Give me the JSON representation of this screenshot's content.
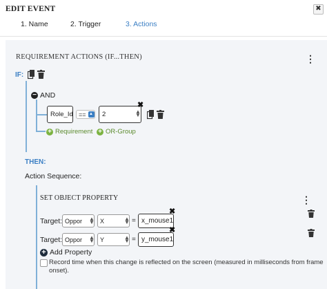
{
  "dialog": {
    "title": "EDIT EVENT",
    "close": "✖"
  },
  "steps": [
    {
      "label": "1. Name"
    },
    {
      "label": "2. Trigger"
    },
    {
      "label": "3. Actions"
    }
  ],
  "requirement": {
    "title": "REQUIREMENT ACTIONS (IF...THEN)",
    "menu_icon": "⋮",
    "if_label": "IF:",
    "and_label": "AND",
    "condition": {
      "left_value": "Role_Id",
      "operator": "==",
      "right_value": "2",
      "remove": "✖"
    },
    "add_requirement": "Requirement",
    "add_or_group": "OR-Group"
  },
  "then": {
    "label": "THEN:",
    "sequence_label": "Action Sequence:",
    "action": {
      "title": "SET OBJECT PROPERTY",
      "menu_icon": "⋮",
      "rows": [
        {
          "label": "Target:",
          "object": "Oppor",
          "property": "X",
          "eq": "=",
          "value": "x_mouse1",
          "remove": "✖"
        },
        {
          "label": "Target:",
          "object": "Oppor",
          "property": "Y",
          "eq": "=",
          "value": "y_mouse1",
          "remove": "✖"
        }
      ],
      "add_property": "Add Property",
      "record_text": "Record time when this change is reflected on the screen (measured in milliseconds from frame onset).",
      "record_checked": false
    }
  },
  "colors": {
    "accent_blue": "#3b7fc4",
    "green": "#7cb342",
    "tree_line": "#7fb0d8"
  }
}
